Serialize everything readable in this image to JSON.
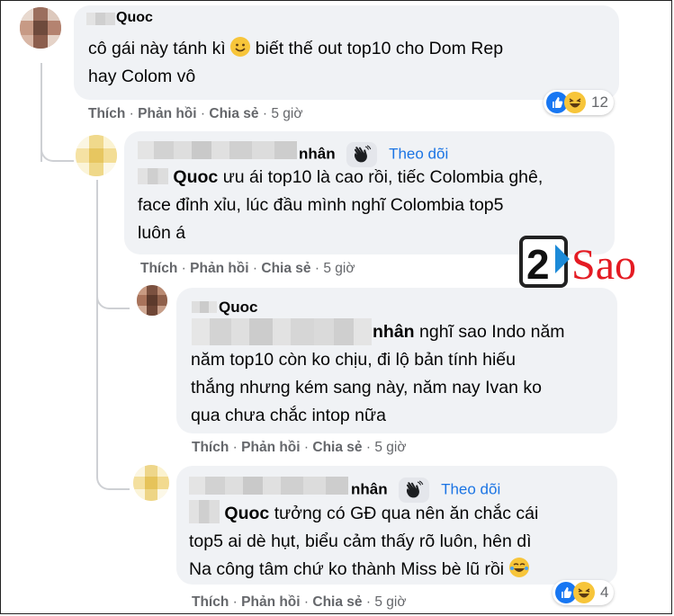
{
  "comments": [
    {
      "author": "Quoc",
      "text_parts": [
        "cô gái này tánh kì",
        "biết thế out top10 cho Dom Rep",
        "hay Colom vô"
      ],
      "actions": {
        "like": "Thích",
        "reply": "Phản hồi",
        "share": "Chia sẻ",
        "time": "5 giờ"
      },
      "reaction_count": "12"
    },
    {
      "author_suffix": "nhân",
      "follow": "Theo dõi",
      "mention": "Quoc",
      "lines": [
        "ưu ái top10 là cao rồi, tiếc Colombia ghê,",
        "face đỉnh xỉu, lúc đầu mình nghĩ Colombia top5",
        "luôn á"
      ],
      "actions": {
        "like": "Thích",
        "reply": "Phản hồi",
        "share": "Chia sẻ",
        "time": "5 giờ"
      }
    },
    {
      "author": "Quoc",
      "mention": "nhân",
      "lines": [
        "nghĩ sao Indo năm",
        "năm top10 còn ko chịu, đi lộ bản tính hiếu",
        "thắng nhưng kém sang này, năm nay Ivan ko",
        "qua chưa chắc intop nữa"
      ],
      "actions": {
        "like": "Thích",
        "reply": "Phản hồi",
        "share": "Chia sẻ",
        "time": "5 giờ"
      }
    },
    {
      "author_suffix": "nhân",
      "follow": "Theo dõi",
      "mention": "Quoc",
      "lines": [
        "tưởng có GĐ qua nên ăn chắc cái",
        "top5 ai dè hụt, biểu cảm thấy rõ luôn, hên dì",
        "Na công tâm chứ ko thành Miss bè lũ rồi"
      ],
      "actions": {
        "like": "Thích",
        "reply": "Phản hồi",
        "share": "Chia sẻ",
        "time": "5 giờ"
      },
      "reaction_count": "4"
    }
  ],
  "separator": "·",
  "watermark": {
    "number": "2",
    "word": "Sao"
  },
  "icons": {
    "like": "like-reaction-icon",
    "haha": "haha-reaction-icon",
    "smile": "smile-emoji-icon",
    "wave": "waving-hand-icon"
  },
  "colors": {
    "bubble": "#f0f2f5",
    "link": "#1b74e4",
    "meta": "#65676b",
    "brand_red": "#e41b23"
  }
}
